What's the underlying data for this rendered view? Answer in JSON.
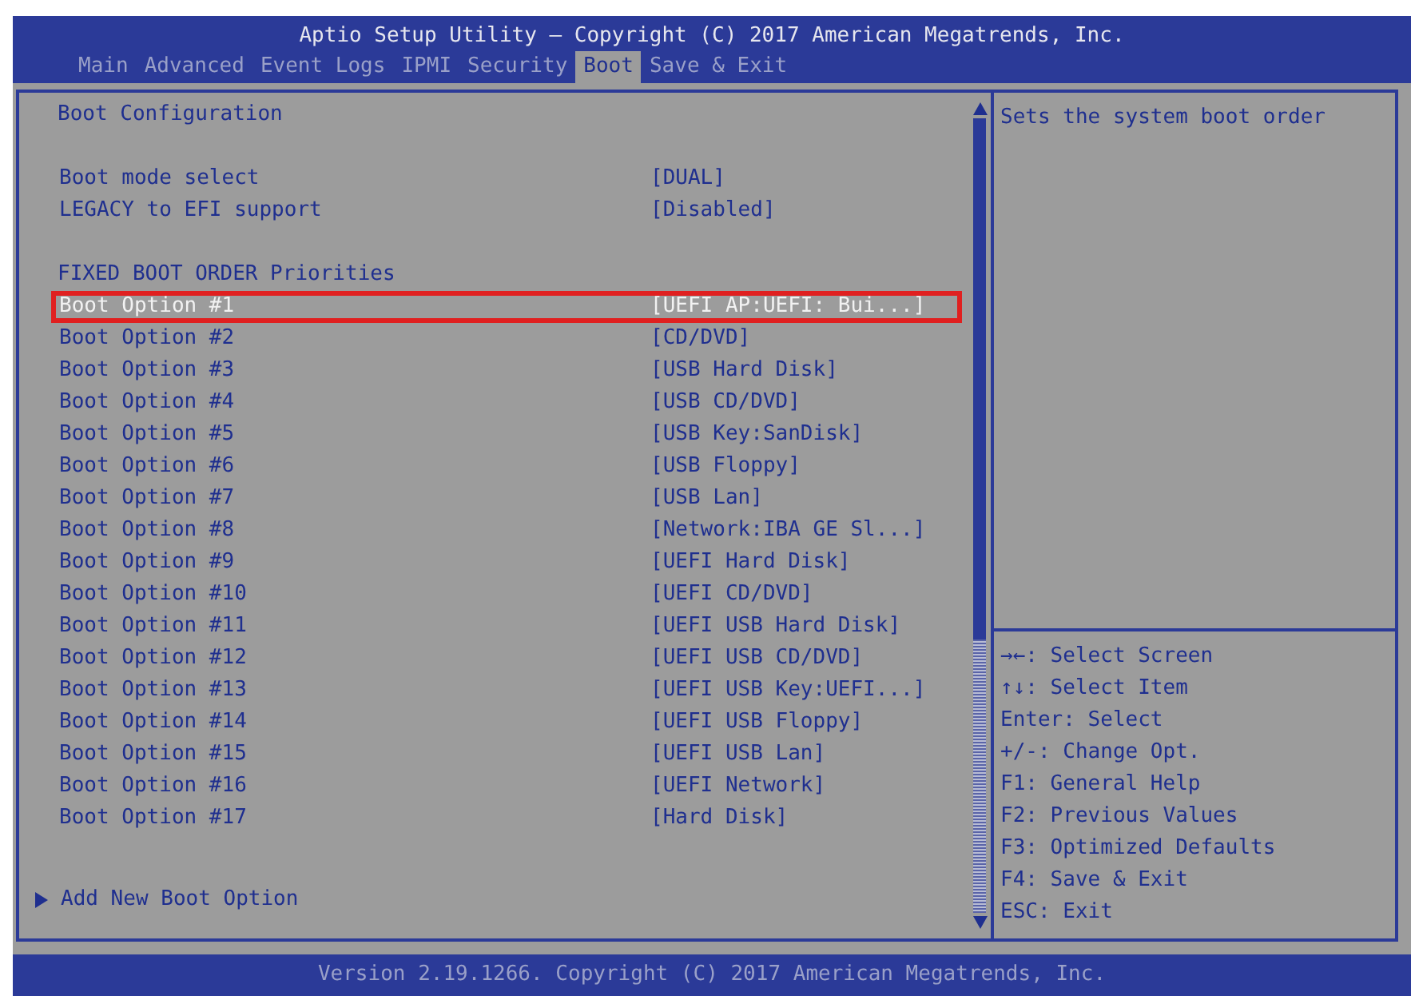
{
  "window": {
    "title": "Aptio Setup Utility – Copyright (C) 2017 American Megatrends, Inc."
  },
  "tabs": [
    {
      "label": "Main",
      "selected": false
    },
    {
      "label": "Advanced",
      "selected": false
    },
    {
      "label": "Event Logs",
      "selected": false
    },
    {
      "label": "IPMI",
      "selected": false
    },
    {
      "label": "Security",
      "selected": false
    },
    {
      "label": "Boot",
      "selected": true
    },
    {
      "label": "Save & Exit",
      "selected": false
    }
  ],
  "groups": [
    {
      "items": [
        {
          "kind": "heading",
          "label": "Boot Configuration"
        }
      ]
    },
    {
      "items": [
        {
          "kind": "setting",
          "label": "Boot mode select",
          "value": "[DUAL]",
          "selected": false
        },
        {
          "kind": "setting",
          "label": "LEGACY to EFI support",
          "value": "[Disabled]",
          "selected": false
        }
      ]
    },
    {
      "items": [
        {
          "kind": "heading",
          "label": "FIXED BOOT ORDER Priorities"
        },
        {
          "kind": "setting",
          "label": "Boot Option #1",
          "value": "[UEFI AP:UEFI: Bui...]",
          "selected": true
        },
        {
          "kind": "setting",
          "label": "Boot Option #2",
          "value": "[CD/DVD]",
          "selected": false
        },
        {
          "kind": "setting",
          "label": "Boot Option #3",
          "value": "[USB Hard Disk]",
          "selected": false
        },
        {
          "kind": "setting",
          "label": "Boot Option #4",
          "value": "[USB CD/DVD]",
          "selected": false
        },
        {
          "kind": "setting",
          "label": "Boot Option #5",
          "value": "[USB Key:SanDisk]",
          "selected": false
        },
        {
          "kind": "setting",
          "label": "Boot Option #6",
          "value": "[USB Floppy]",
          "selected": false
        },
        {
          "kind": "setting",
          "label": "Boot Option #7",
          "value": "[USB Lan]",
          "selected": false
        },
        {
          "kind": "setting",
          "label": "Boot Option #8",
          "value": "[Network:IBA GE Sl...]",
          "selected": false
        },
        {
          "kind": "setting",
          "label": "Boot Option #9",
          "value": "[UEFI Hard Disk]",
          "selected": false
        },
        {
          "kind": "setting",
          "label": "Boot Option #10",
          "value": "[UEFI CD/DVD]",
          "selected": false
        },
        {
          "kind": "setting",
          "label": "Boot Option #11",
          "value": "[UEFI USB Hard Disk]",
          "selected": false
        },
        {
          "kind": "setting",
          "label": "Boot Option #12",
          "value": "[UEFI USB CD/DVD]",
          "selected": false
        },
        {
          "kind": "setting",
          "label": "Boot Option #13",
          "value": "[UEFI USB Key:UEFI...]",
          "selected": false
        },
        {
          "kind": "setting",
          "label": "Boot Option #14",
          "value": "[UEFI USB Floppy]",
          "selected": false
        },
        {
          "kind": "setting",
          "label": "Boot Option #15",
          "value": "[UEFI USB Lan]",
          "selected": false
        },
        {
          "kind": "setting",
          "label": "Boot Option #16",
          "value": "[UEFI Network]",
          "selected": false
        },
        {
          "kind": "setting",
          "label": "Boot Option #17",
          "value": "[Hard Disk]",
          "selected": false
        }
      ]
    },
    {
      "items": [
        {
          "kind": "submenu",
          "label": "Add New Boot Option",
          "selected": false
        }
      ]
    }
  ],
  "help": {
    "text": "Sets the system boot order"
  },
  "keys": [
    "→←: Select Screen",
    "↑↓: Select Item",
    "Enter: Select",
    "+/-: Change Opt.",
    "F1: General Help",
    "F2: Previous Values",
    "F3: Optimized Defaults",
    "F4: Save & Exit",
    "ESC: Exit"
  ],
  "status_bar": {
    "text": "Version 2.19.1266. Copyright (C) 2017 American Megatrends, Inc."
  }
}
